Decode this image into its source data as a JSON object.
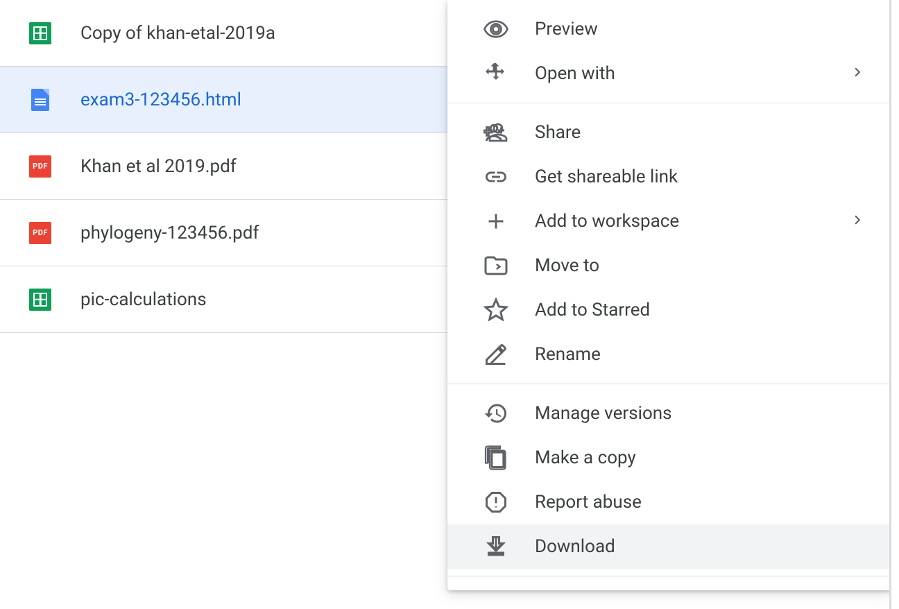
{
  "files": [
    {
      "name": "Copy of khan-etal-2019a",
      "type": "sheets",
      "selected": false
    },
    {
      "name": "exam3-123456.html",
      "type": "docs",
      "selected": true
    },
    {
      "name": "Khan et al 2019.pdf",
      "type": "pdf",
      "selected": false
    },
    {
      "name": "phylogeny-123456.pdf",
      "type": "pdf",
      "selected": false
    },
    {
      "name": "pic-calculations",
      "type": "sheets",
      "selected": false
    }
  ],
  "menu": {
    "preview": "Preview",
    "open_with": "Open with",
    "share": "Share",
    "get_link": "Get shareable link",
    "add_workspace": "Add to workspace",
    "move_to": "Move to",
    "add_starred": "Add to Starred",
    "rename": "Rename",
    "manage_versions": "Manage versions",
    "make_copy": "Make a copy",
    "report_abuse": "Report abuse",
    "download": "Download"
  }
}
